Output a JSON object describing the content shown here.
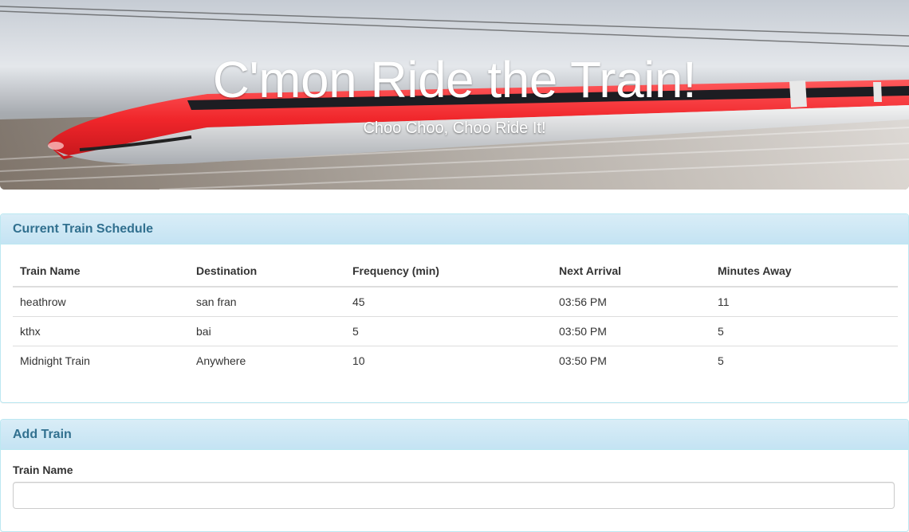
{
  "hero": {
    "title": "C'mon Ride the Train!",
    "subtitle": "Choo Choo, Choo Ride It!",
    "train_color": "#f23a3e"
  },
  "schedule": {
    "heading": "Current Train Schedule",
    "columns": [
      "Train Name",
      "Destination",
      "Frequency (min)",
      "Next Arrival",
      "Minutes Away"
    ],
    "rows": [
      [
        "heathrow",
        "san fran",
        "45",
        "03:56 PM",
        "11"
      ],
      [
        "kthx",
        "bai",
        "5",
        "03:50 PM",
        "5"
      ],
      [
        "Midnight Train",
        "Anywhere",
        "10",
        "03:50 PM",
        "5"
      ]
    ]
  },
  "add_train": {
    "heading": "Add Train",
    "train_name_label": "Train Name",
    "train_name_value": ""
  },
  "colors": {
    "panel_heading_bg": "#d9edf7",
    "panel_heading_text": "#31708f",
    "panel_border": "#bce8f1"
  }
}
